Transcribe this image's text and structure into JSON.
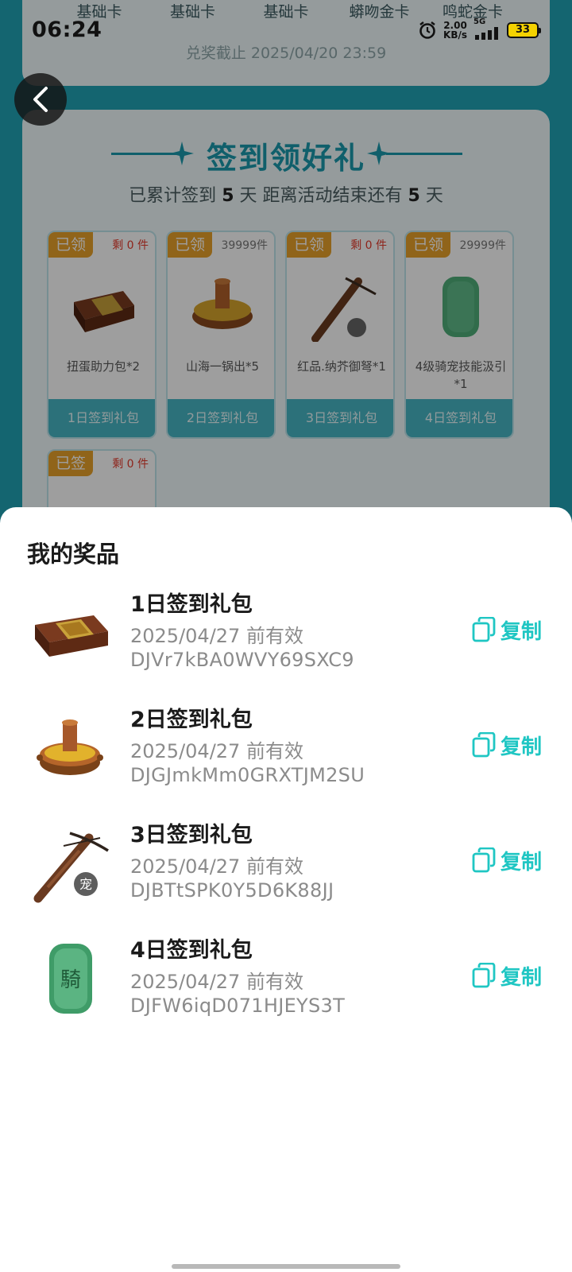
{
  "status_bar": {
    "time": "06:24",
    "net_speed_value": "2.00",
    "net_speed_unit": "KB/s",
    "network": "5G",
    "battery": "33"
  },
  "background": {
    "card_types": [
      "基础卡",
      "基础卡",
      "基础卡",
      "蟒吻金卡",
      "鸣蛇金卡"
    ],
    "deadline": "兑奖截止 2025/04/20 23:59",
    "signin": {
      "title": "签到领好礼",
      "subtitle_prefix": "已累计签到",
      "days_signed": "5",
      "subtitle_mid": "天  距离活动结束还有",
      "days_left": "5",
      "subtitle_suffix": "天",
      "rewards": [
        {
          "tag": "已领",
          "stock": "剩 0 件",
          "name": "扭蛋助力包*2",
          "footer": "1日签到礼包"
        },
        {
          "tag": "已领",
          "stock": "39999件",
          "name": "山海一锅出*5",
          "footer": "2日签到礼包"
        },
        {
          "tag": "已领",
          "stock": "剩 0 件",
          "name": "红品.纳芥御弩*1",
          "footer": "3日签到礼包"
        },
        {
          "tag": "已领",
          "stock": "29999件",
          "name": "4级骑宠技能汲引*1",
          "footer": "4日签到礼包"
        }
      ],
      "next_tag": "已签",
      "next_stock": "剩 0 件"
    }
  },
  "sheet": {
    "title": "我的奖品",
    "copy_label": "复制",
    "prizes": [
      {
        "name": "1日签到礼包",
        "expiry": "2025/04/27 前有效",
        "code": "DJVr7kBA0WVY69SXC9",
        "icon": "chest-icon"
      },
      {
        "name": "2日签到礼包",
        "expiry": "2025/04/27 前有效",
        "code": "DJGJmkMm0GRXTJM2SU",
        "icon": "hotpot-icon"
      },
      {
        "name": "3日签到礼包",
        "expiry": "2025/04/27 前有效",
        "code": "DJBTtSPK0Y5D6K88JJ",
        "icon": "crossbow-icon"
      },
      {
        "name": "4日签到礼包",
        "expiry": "2025/04/27 前有效",
        "code": "DJFW6iqD071HJEYS3T",
        "icon": "jade-seal-icon"
      }
    ],
    "pet_badge": "宠",
    "seal_char": "騎"
  },
  "colors": {
    "accent": "#1fc6c3",
    "tag_orange": "#e9a22a",
    "page_teal": "#21a3b5"
  }
}
